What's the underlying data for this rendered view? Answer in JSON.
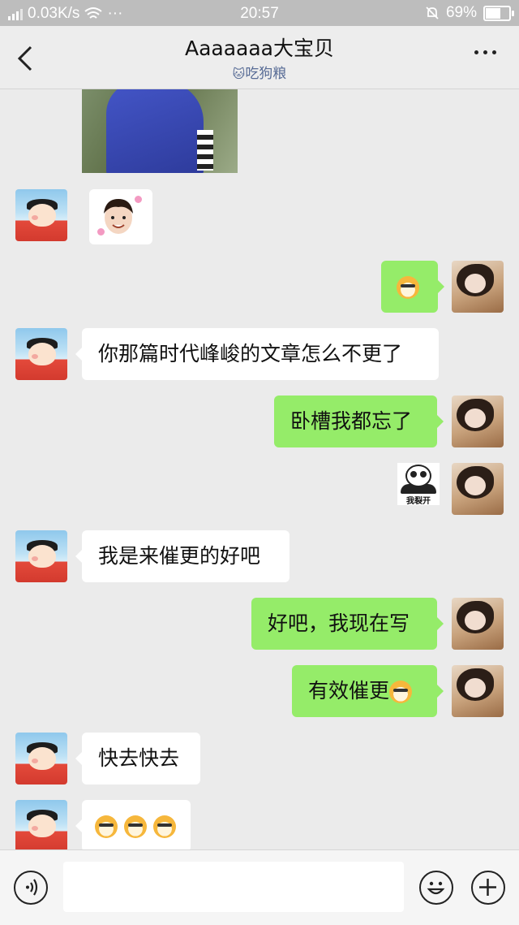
{
  "status": {
    "speed": "0.03K/s",
    "time": "20:57",
    "battery": "69%",
    "battery_fraction": 0.69
  },
  "header": {
    "title": "Aaaaaaa大宝贝",
    "subtitle": "吃狗粮",
    "subtitle_icon": "cat-icon"
  },
  "messages": [
    {
      "side": "in",
      "type": "photo"
    },
    {
      "side": "in",
      "type": "sticker",
      "sticker": "kid-face-sticker"
    },
    {
      "side": "out",
      "type": "sticker",
      "sticker": "doge-emoji"
    },
    {
      "side": "in",
      "type": "text",
      "text": "你那篇时代峰峻的文章怎么不更了"
    },
    {
      "side": "out",
      "type": "text",
      "text": "卧槽我都忘了"
    },
    {
      "side": "out",
      "type": "sticker",
      "sticker": "panda-sticker",
      "caption": "我裂开"
    },
    {
      "side": "in",
      "type": "text",
      "text": "我是来催更的好吧"
    },
    {
      "side": "out",
      "type": "text",
      "text": "好吧，我现在写"
    },
    {
      "side": "out",
      "type": "text",
      "text": "有效催更",
      "trailing_emoji": "doge-emoji"
    },
    {
      "side": "in",
      "type": "text",
      "text": "快去快去"
    },
    {
      "side": "in",
      "type": "emoji",
      "emoji": [
        "doge-emoji",
        "doge-emoji",
        "doge-emoji"
      ]
    }
  ],
  "inputbar": {
    "voice_icon": "voice-icon",
    "emoji_icon": "smiley-icon",
    "plus_icon": "plus-icon"
  }
}
